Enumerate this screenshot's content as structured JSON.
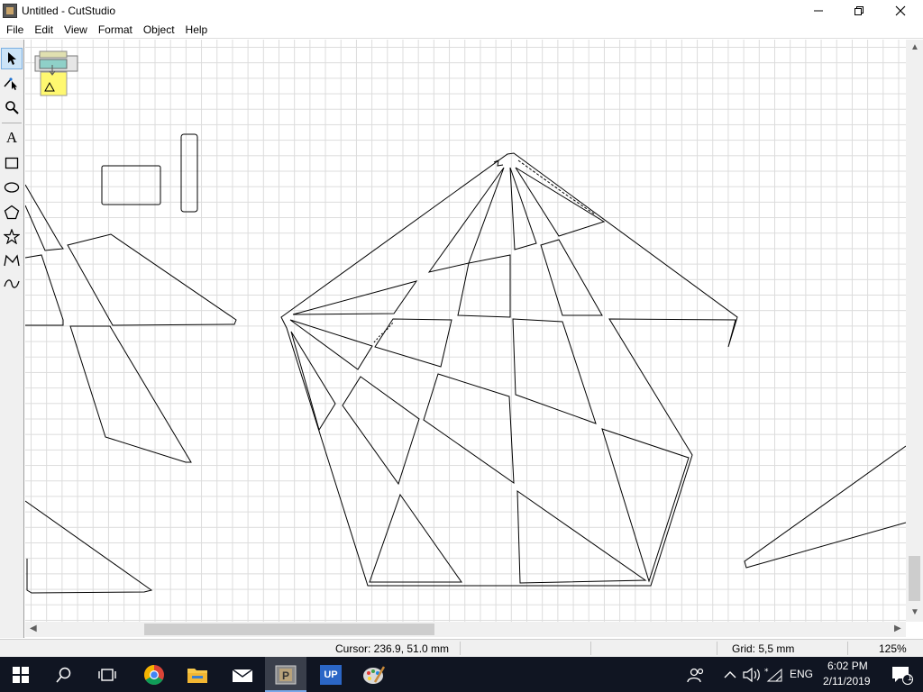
{
  "window": {
    "title": "Untitled - CutStudio",
    "minimize_icon": "minimize-icon",
    "maximize_icon": "restore-icon",
    "close_icon": "close-icon"
  },
  "menu": [
    "File",
    "Edit",
    "View",
    "Format",
    "Object",
    "Help"
  ],
  "toolbox": {
    "tools": [
      {
        "name": "select-tool",
        "icon": "arrow-pointer-icon",
        "active": true
      },
      {
        "name": "node-edit-tool",
        "icon": "node-edit-icon",
        "active": false
      },
      {
        "name": "zoom-tool",
        "icon": "magnifier-icon",
        "active": false
      },
      {
        "name": "text-tool",
        "icon": "text-a-icon",
        "active": false,
        "glyph": "A"
      },
      {
        "name": "rectangle-tool",
        "icon": "rectangle-icon",
        "active": false
      },
      {
        "name": "ellipse-tool",
        "icon": "ellipse-icon",
        "active": false
      },
      {
        "name": "polygon-tool",
        "icon": "pentagon-icon",
        "active": false
      },
      {
        "name": "star-tool",
        "icon": "star-icon",
        "active": false
      },
      {
        "name": "polyline-tool",
        "icon": "polyline-icon",
        "active": false
      },
      {
        "name": "curve-tool",
        "icon": "curve-icon",
        "active": false
      }
    ]
  },
  "canvas": {
    "cutter_icon": "cutter-machine-icon",
    "grid": true
  },
  "status": {
    "cursor": "Cursor: 236.9, 51.0 mm",
    "grid": "Grid: 5,5 mm",
    "zoom": "125%"
  },
  "taskbar": {
    "apps": [
      {
        "name": "start-button",
        "icon": "windows-logo-icon"
      },
      {
        "name": "search-button",
        "icon": "search-icon"
      },
      {
        "name": "task-view-button",
        "icon": "task-view-icon"
      },
      {
        "name": "chrome-app",
        "icon": "chrome-icon"
      },
      {
        "name": "file-explorer-app",
        "icon": "folder-icon"
      },
      {
        "name": "mail-app",
        "icon": "mail-icon"
      },
      {
        "name": "cutstudio-app",
        "icon": "cutstudio-icon",
        "active": true
      },
      {
        "name": "up-app",
        "icon": "up-icon",
        "label": "UP"
      },
      {
        "name": "paint-app",
        "icon": "palette-icon"
      }
    ],
    "tray": {
      "language": "ENG",
      "time": "6:02 PM",
      "date": "2/11/2019",
      "notification_count": "1"
    }
  }
}
